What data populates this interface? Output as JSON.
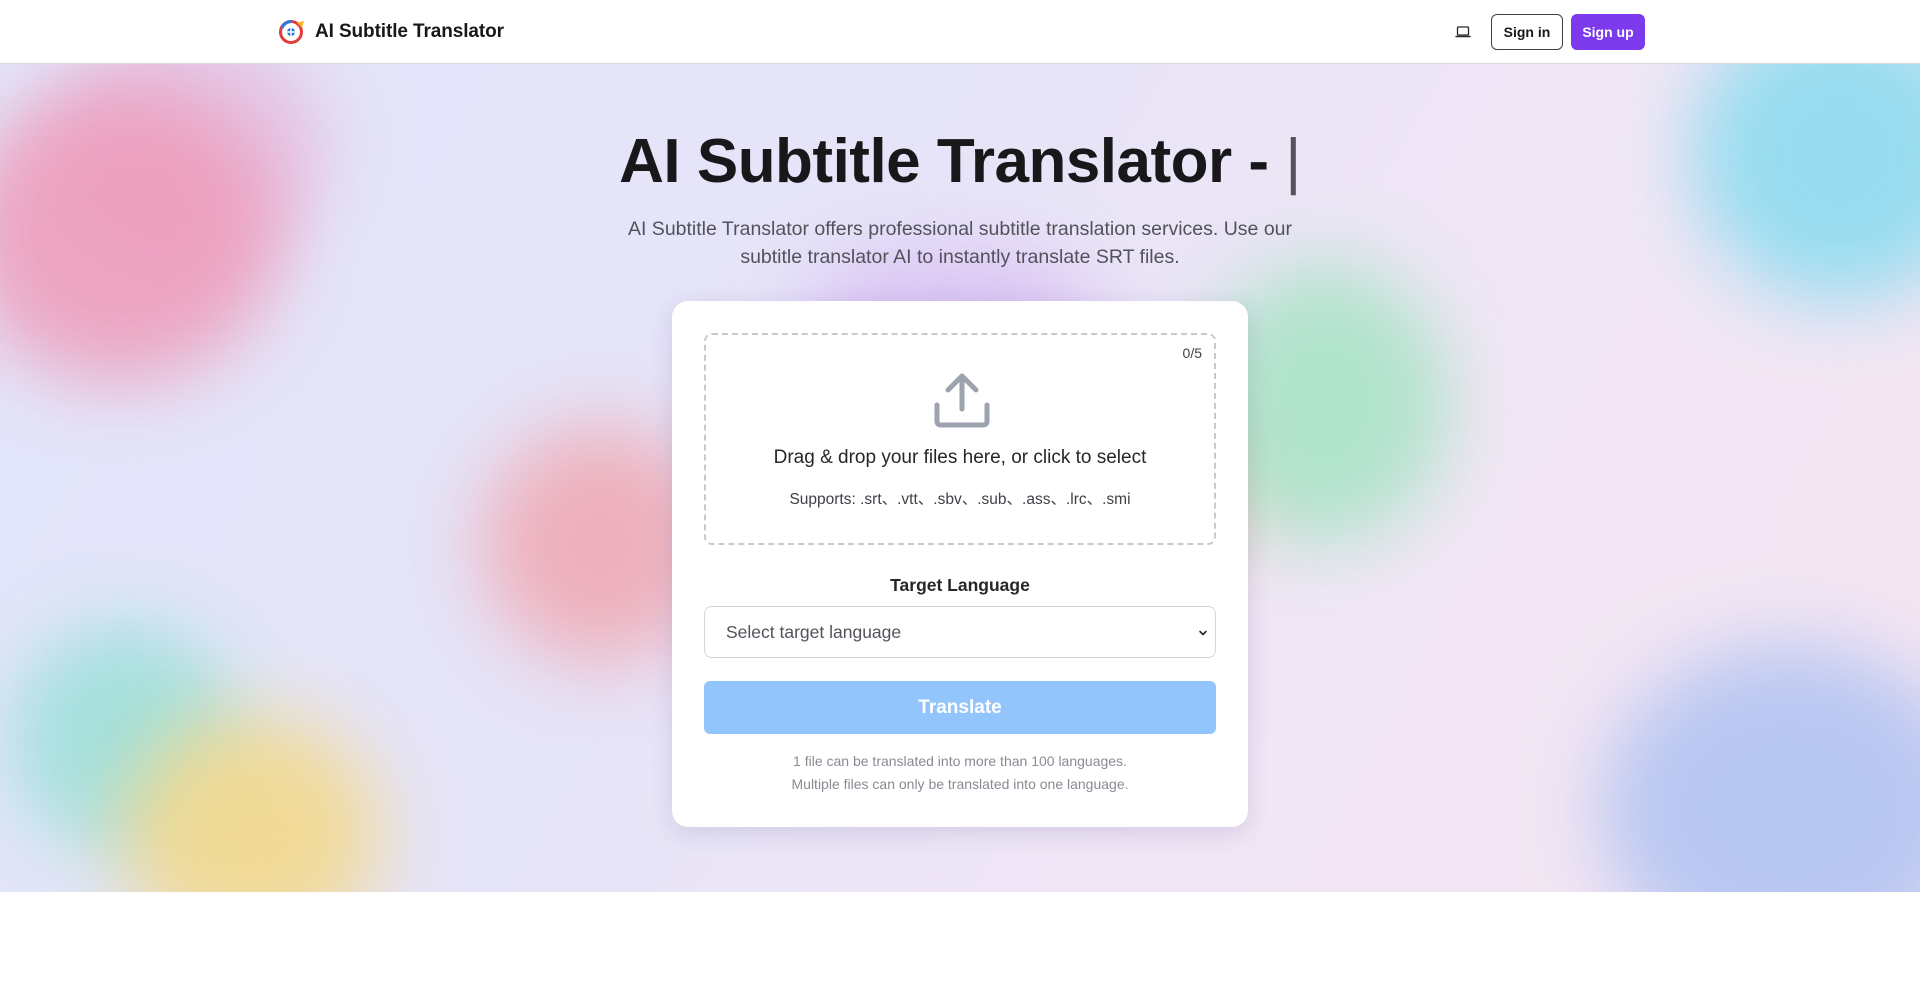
{
  "header": {
    "brand_name": "AI Subtitle Translator",
    "signin_label": "Sign in",
    "signup_label": "Sign up",
    "theme_icon": "laptop-icon",
    "accent_color": "#7c3aed"
  },
  "hero": {
    "title": "AI Subtitle Translator -",
    "cursor": "|",
    "subtitle": "AI Subtitle Translator offers professional subtitle translation services. Use our subtitle translator AI to instantly translate SRT files."
  },
  "uploader": {
    "file_count": "0/5",
    "drop_text": "Drag & drop your files here, or click to select",
    "supports_text": "Supports: .srt、.vtt、.sbv、.sub、.ass、.lrc、.smi",
    "upload_icon": "upload-icon"
  },
  "form": {
    "target_label": "Target Language",
    "select_placeholder": "Select target language",
    "translate_label": "Translate",
    "translate_color": "#93c5fd",
    "note_line1": "1 file can be translated into more than 100 languages.",
    "note_line2": "Multiple files can only be translated into one language."
  }
}
